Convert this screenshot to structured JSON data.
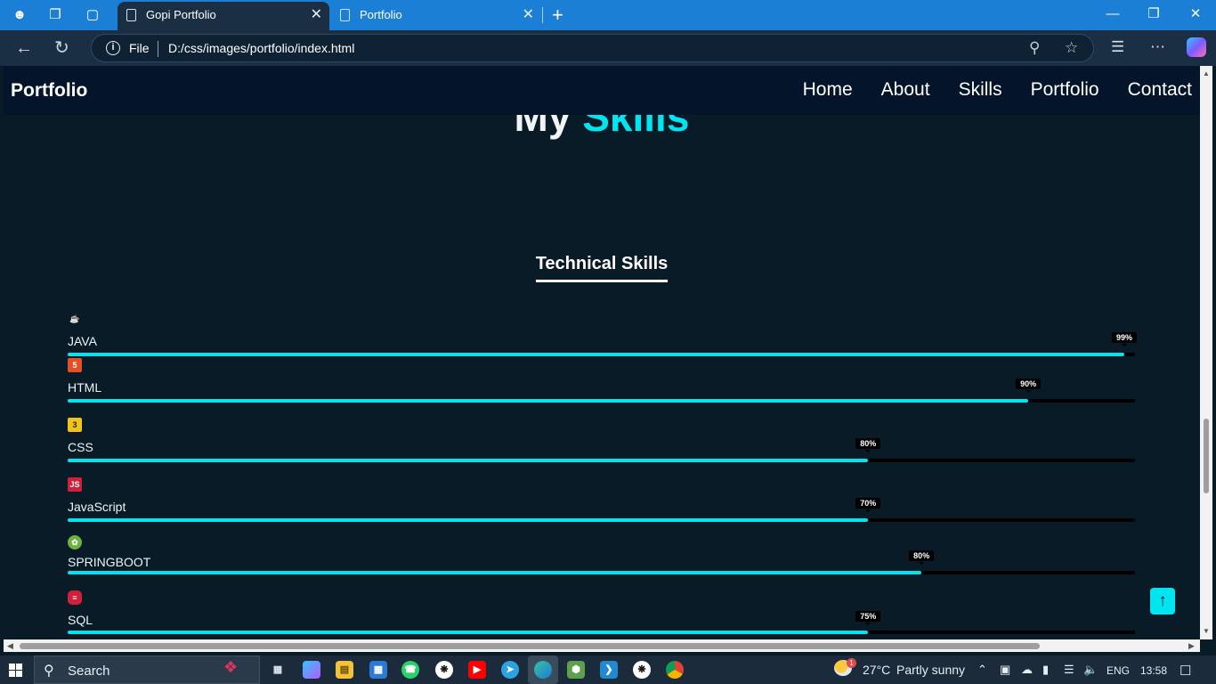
{
  "browser": {
    "tabs": [
      {
        "title": "Gopi Portfolio",
        "active": true
      },
      {
        "title": "Portfolio",
        "active": false
      }
    ],
    "address": {
      "scheme_label": "File",
      "url": "D:/css/images/portfolio/index.html"
    }
  },
  "site": {
    "brand": "Portfolio",
    "nav": [
      "Home",
      "About",
      "Skills",
      "Portfolio",
      "Contact"
    ],
    "heading": {
      "part1": "My",
      "part2": "Skills"
    },
    "technical_title": "Technical Skills",
    "skills": [
      {
        "name": "JAVA",
        "percent_label": "99%",
        "level": 0.99,
        "icon": "java-icon"
      },
      {
        "name": "HTML",
        "percent_label": "90%",
        "level": 0.9,
        "icon": "html5-icon"
      },
      {
        "name": "CSS",
        "percent_label": "80%",
        "level": 0.75,
        "icon": "css3-icon"
      },
      {
        "name": "JavaScript",
        "percent_label": "70%",
        "level": 0.75,
        "icon": "javascript-icon"
      },
      {
        "name": "SPRINGBOOT",
        "percent_label": "80%",
        "level": 0.8,
        "icon": "spring-icon"
      },
      {
        "name": "SQL",
        "percent_label": "75%",
        "level": 0.75,
        "icon": "database-icon"
      }
    ],
    "accent_color": "#00e5f0",
    "back_to_top_icon": "arrow-up-icon"
  },
  "taskbar": {
    "search_label": "Search",
    "weather": {
      "temp": "27°C",
      "condition": "Partly sunny",
      "badge": "1"
    },
    "language": "ENG",
    "time": "13:58"
  }
}
